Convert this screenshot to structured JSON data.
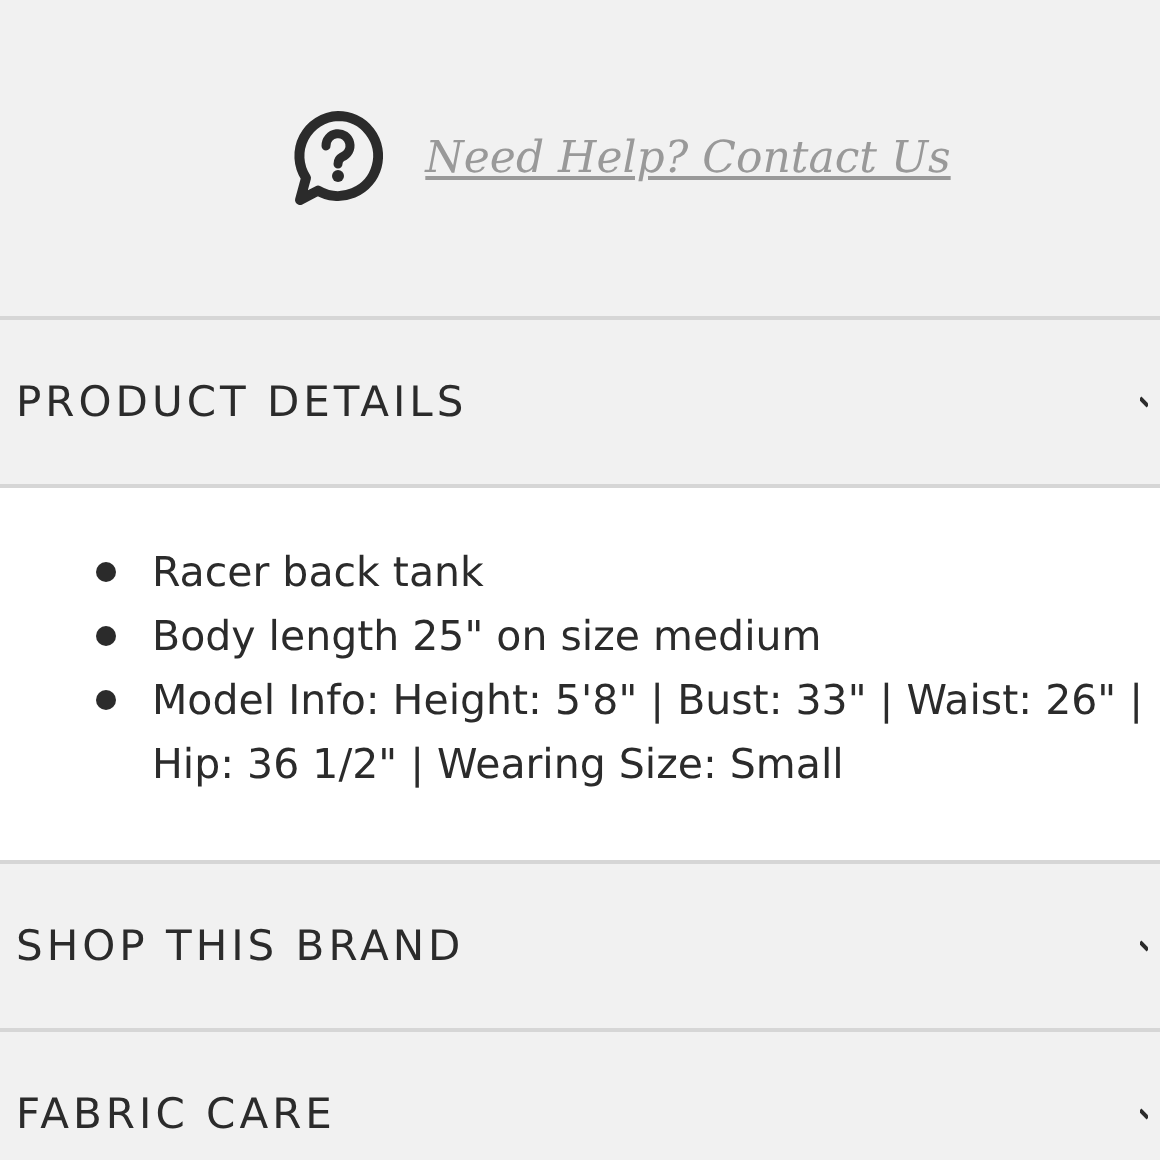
{
  "help": {
    "link": "Need Help? Contact Us"
  },
  "sections": [
    {
      "title": "PRODUCT DETAILS",
      "items": [
        "Racer back tank",
        "Body length 25\" on size medium",
        "Model Info: Height: 5'8\" | Bust: 33\" | Waist: 26\" | Hip: 36 1/2\" | Wearing Size: Small"
      ]
    },
    {
      "title": "SHOP THIS BRAND"
    },
    {
      "title": "FABRIC CARE"
    }
  ]
}
